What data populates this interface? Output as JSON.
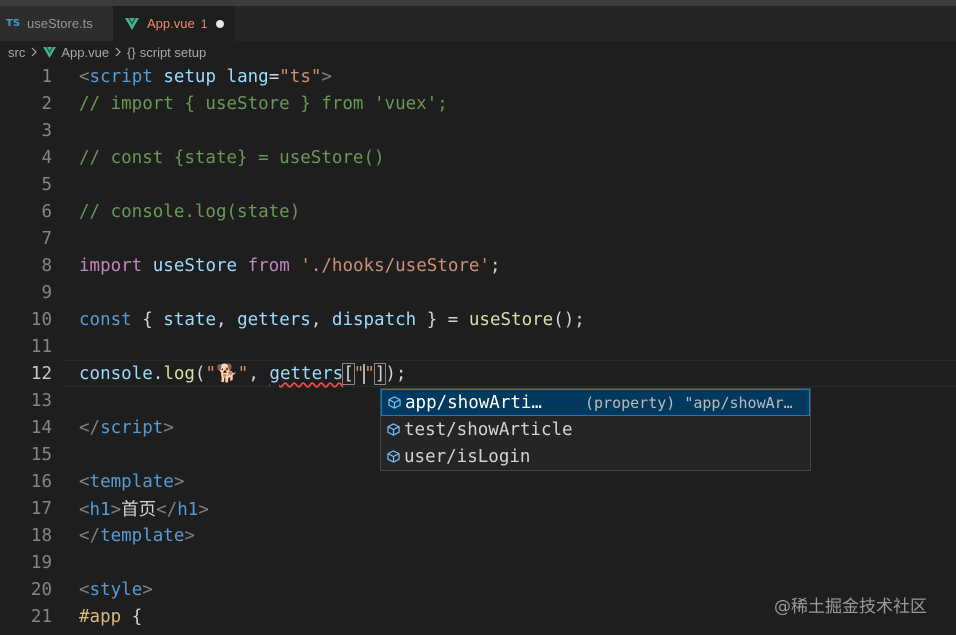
{
  "tabs": [
    {
      "icon": "TS",
      "label": "useStore.ts"
    },
    {
      "label": "App.vue",
      "error_count": "1"
    }
  ],
  "breadcrumb": {
    "root": "src",
    "file": "App.vue",
    "braces": "{}",
    "symbol": "script setup"
  },
  "line_numbers": [
    "1",
    "2",
    "3",
    "4",
    "5",
    "6",
    "7",
    "8",
    "9",
    "10",
    "11",
    "12",
    "13",
    "14",
    "15",
    "16",
    "17",
    "18",
    "19",
    "20",
    "21"
  ],
  "current_line": "12",
  "code": {
    "l1": {
      "open": "<",
      "tag": "script",
      "a1": "setup",
      "a2": "lang",
      "eq": "=",
      "val": "\"ts\"",
      "close": ">"
    },
    "l2": "// import { useStore } from 'vuex';",
    "l4": "// const {state} = useStore()",
    "l6": "// console.log(state)",
    "l8": {
      "kw1": "import",
      "name": "useStore",
      "kw2": "from",
      "path": "'./hooks/useStore'",
      "semi": ";"
    },
    "l10": {
      "decl": "const",
      "ob": " { ",
      "v1": "state",
      "c1": ", ",
      "v2": "getters",
      "c2": ", ",
      "v3": "dispatch",
      "cb": " } = ",
      "fn": "useStore",
      "end": "();"
    },
    "l12": {
      "obj": "console",
      "dot": ".",
      "fn": "log",
      "op": "(",
      "str": "\"🐕\"",
      "comma": ", ",
      "getters": "getters",
      "ob": "[",
      "q1": "\"",
      "q2": "\"",
      "cb": "]",
      "end": ");"
    },
    "l14": {
      "open": "</",
      "tag": "script",
      "close": ">"
    },
    "l16": {
      "open": "<",
      "tag": "template",
      "close": ">"
    },
    "l17": {
      "open": "<",
      "tag": "h1",
      "close": ">",
      "text": "首页",
      "open2": "</",
      "tag2": "h1",
      "close2": ">"
    },
    "l18": {
      "open": "</",
      "tag": "template",
      "close": ">"
    },
    "l20": {
      "open": "<",
      "tag": "style",
      "close": ">"
    },
    "l21": {
      "sel": "#app",
      "brace": " {"
    }
  },
  "suggestions": [
    {
      "label": "app/showArti…",
      "detail": "(property) \"app/showAr…",
      "selected": true
    },
    {
      "label": "test/showArticle"
    },
    {
      "label": "user/isLogin"
    }
  ],
  "watermark": "@稀土掘金技术社区",
  "colors": {
    "accent": "#007fd4",
    "error": "#f48771",
    "vue_green": "#41b883"
  }
}
